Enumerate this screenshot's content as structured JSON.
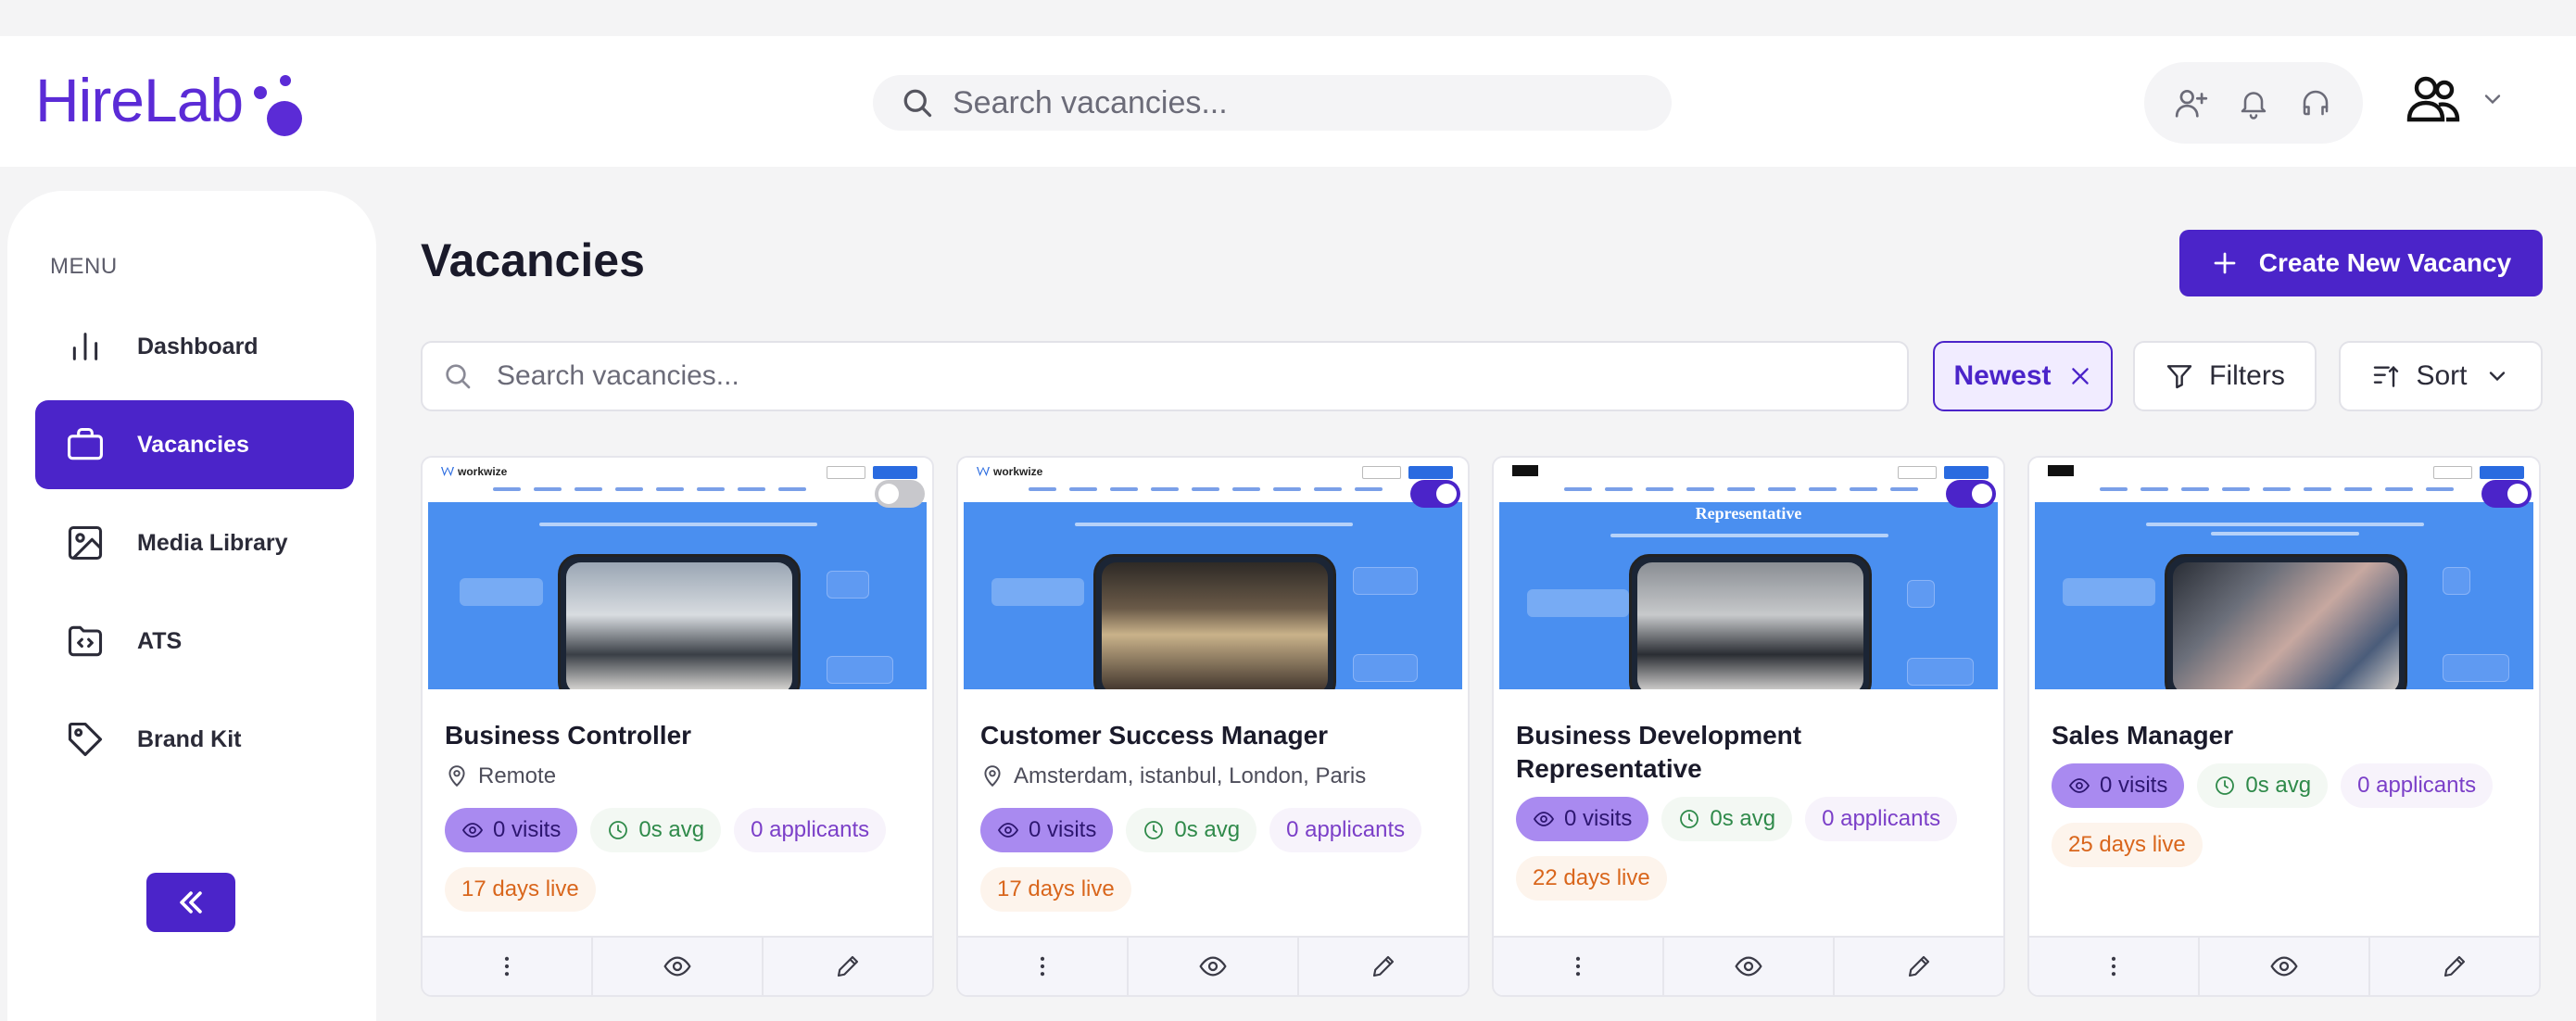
{
  "header": {
    "logo_text": "HireLab",
    "search_placeholder": "Search vacancies..."
  },
  "sidebar": {
    "menu_label": "MENU",
    "items": [
      {
        "label": "Dashboard",
        "icon": "bar-chart-icon",
        "active": false
      },
      {
        "label": "Vacancies",
        "icon": "briefcase-icon",
        "active": true
      },
      {
        "label": "Media Library",
        "icon": "image-icon",
        "active": false
      },
      {
        "label": "ATS",
        "icon": "folder-code-icon",
        "active": false
      },
      {
        "label": "Brand Kit",
        "icon": "tag-icon",
        "active": false
      }
    ],
    "collapse_icon": "double-chevron-left-icon"
  },
  "main": {
    "title": "Vacancies",
    "create_button": "Create New Vacancy",
    "search_placeholder": "Search vacancies...",
    "active_filter": "Newest",
    "filters_label": "Filters",
    "sort_label": "Sort"
  },
  "colors": {
    "brand": "#4b24c9",
    "logo": "#5b2bd6",
    "thumb_blue": "#4a8ff0",
    "visits_bg": "#a98af0",
    "avg_text": "#2f8a4a",
    "applicants_text": "#7b3fc8",
    "live_text": "#d9661c"
  },
  "vacancies": [
    {
      "title": "Business Controller",
      "location": "Remote",
      "visits": "0 visits",
      "avg": "0s avg",
      "applicants": "0 applicants",
      "live": "17 days live",
      "published": false,
      "brand": "workwize"
    },
    {
      "title": "Customer Success Manager",
      "location": "Amsterdam, istanbul, London, Paris",
      "visits": "0 visits",
      "avg": "0s avg",
      "applicants": "0 applicants",
      "live": "17 days live",
      "published": true,
      "brand": "workwize"
    },
    {
      "title": "Business Development Representative",
      "location": "",
      "visits": "0 visits",
      "avg": "0s avg",
      "applicants": "0 applicants",
      "live": "22 days live",
      "published": true,
      "brand": ""
    },
    {
      "title": "Sales Manager",
      "location": "",
      "visits": "0 visits",
      "avg": "0s avg",
      "applicants": "0 applicants",
      "live": "25 days live",
      "published": true,
      "brand": ""
    }
  ],
  "thumb_texts": {
    "card3_heading": "Representative"
  }
}
